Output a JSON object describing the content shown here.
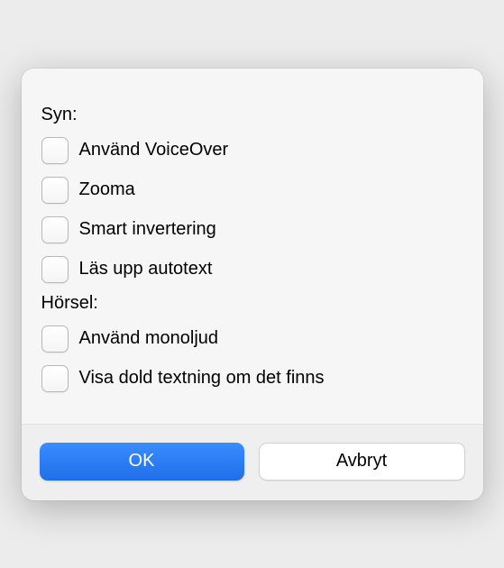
{
  "sections": {
    "vision": {
      "label": "Syn:",
      "options": [
        {
          "label": "Använd VoiceOver"
        },
        {
          "label": "Zooma"
        },
        {
          "label": "Smart invertering"
        },
        {
          "label": "Läs upp autotext"
        }
      ]
    },
    "hearing": {
      "label": "Hörsel:",
      "options": [
        {
          "label": "Använd monoljud"
        },
        {
          "label": "Visa dold textning om det finns"
        }
      ]
    }
  },
  "buttons": {
    "ok": "OK",
    "cancel": "Avbryt"
  }
}
